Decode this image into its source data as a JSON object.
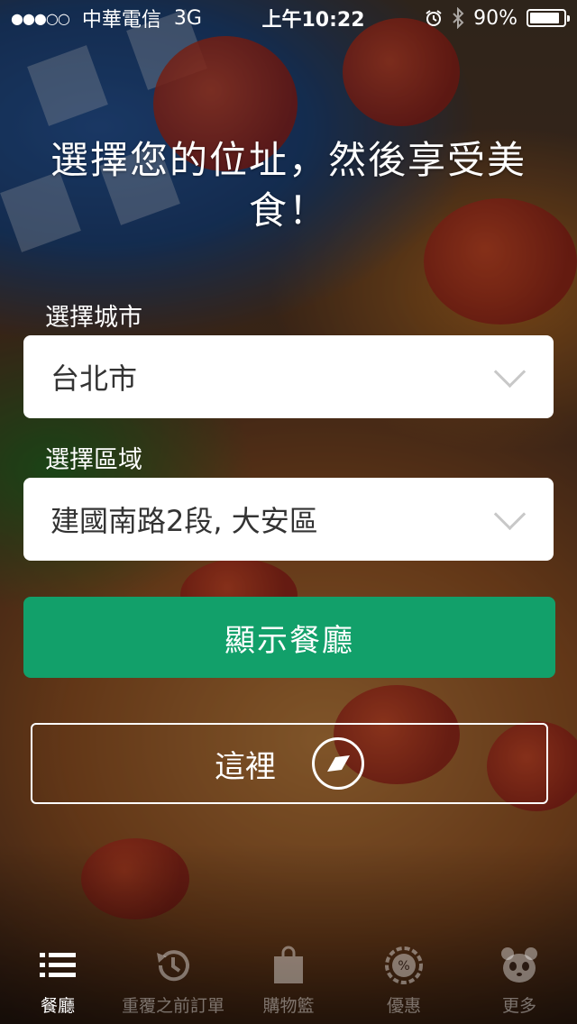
{
  "status_bar": {
    "signal": "●●●○○",
    "carrier": "中華電信",
    "network": "3G",
    "time": "上午10:22",
    "battery_pct": "90%",
    "battery_level": 0.9
  },
  "headline": "選擇您的位址，然後享受美食！",
  "city": {
    "label": "選擇城市",
    "value": "台北市"
  },
  "area": {
    "label": "選擇區域",
    "value": "建國南路2段, 大安區"
  },
  "show_restaurants_label": "顯示餐廳",
  "here_label": "這裡",
  "tabs": [
    {
      "label": "餐廳",
      "icon": "list-icon",
      "active": true
    },
    {
      "label": "重覆之前訂單",
      "icon": "history-icon",
      "active": false
    },
    {
      "label": "購物籃",
      "icon": "bag-icon",
      "active": false
    },
    {
      "label": "優惠",
      "icon": "percent-badge-icon",
      "active": false
    },
    {
      "label": "更多",
      "icon": "panda-icon",
      "active": false
    }
  ],
  "colors": {
    "primary_green": "#12a06a"
  }
}
